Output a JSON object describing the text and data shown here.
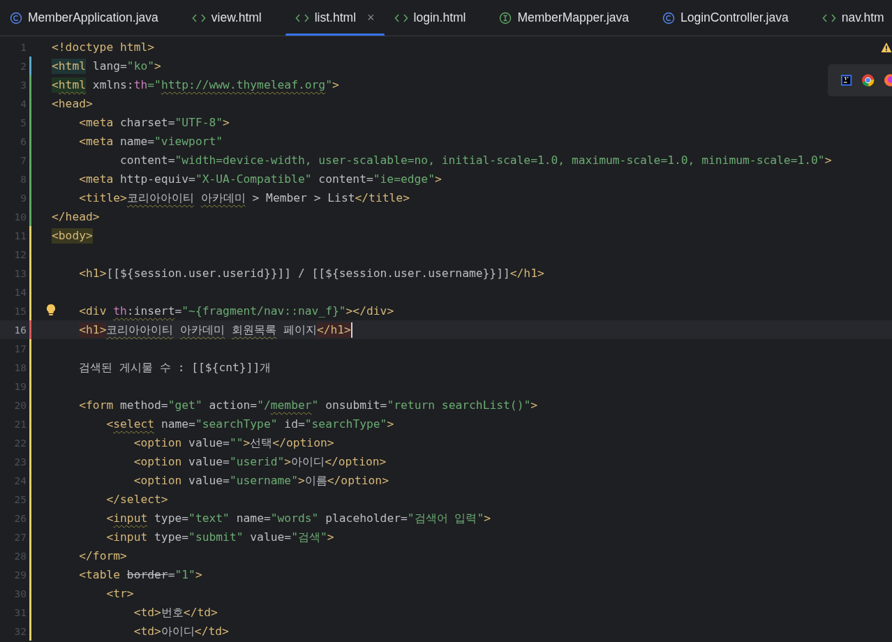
{
  "tabs": [
    {
      "label": "MemberApplication.java",
      "kind": "class",
      "selected": false
    },
    {
      "label": "view.html",
      "kind": "html",
      "selected": false
    },
    {
      "label": "list.html",
      "kind": "html",
      "selected": true,
      "close": "×"
    },
    {
      "label": "login.html",
      "kind": "html",
      "selected": false
    },
    {
      "label": "MemberMapper.java",
      "kind": "interface",
      "selected": false
    },
    {
      "label": "LoginController.java",
      "kind": "class",
      "selected": false
    },
    {
      "label": "nav.htm",
      "kind": "html",
      "selected": false
    }
  ],
  "editor": {
    "warning": true,
    "lines": [
      {
        "n": "1",
        "selected": false,
        "tokens": [
          {
            "t": "<!doctype html>",
            "kind": "tag"
          }
        ]
      },
      {
        "n": "2",
        "selected": false,
        "color": "#5ea7c9",
        "tokens": [
          {
            "t": "<html",
            "kind": "tag",
            "color": "#1f3636"
          },
          {
            "t": " lang=",
            "kind": "attr"
          },
          {
            "t": "\"ko\"",
            "kind": "string"
          },
          {
            "t": ">",
            "kind": "tag"
          }
        ]
      },
      {
        "n": "3",
        "selected": false,
        "color": "#5fa866",
        "tokens": [
          {
            "t": "<",
            "kind": "tag",
            "color": "#1f3524"
          },
          {
            "t": "html",
            "kind": "tag",
            "color": "#1f3524",
            "typo": true
          },
          {
            "t": " xmlns:",
            "kind": "attr"
          },
          {
            "t": "th",
            "kind": "ns"
          },
          {
            "t": "=\"",
            "kind": "string"
          },
          {
            "t": "http://www.thymeleaf.org",
            "kind": "string",
            "typo": true
          },
          {
            "t": "\"",
            "kind": "string"
          },
          {
            "t": ">",
            "kind": "tag"
          }
        ]
      },
      {
        "n": "4",
        "selected": false,
        "color": "#5fa866",
        "tokens": [
          {
            "t": "<head>",
            "kind": "tag"
          }
        ]
      },
      {
        "n": "5",
        "selected": false,
        "color": "#5fa866",
        "tokens": [
          {
            "t": "    <meta",
            "kind": "tag"
          },
          {
            "t": " charset=",
            "kind": "attr"
          },
          {
            "t": "\"UTF-8\"",
            "kind": "string"
          },
          {
            "t": ">",
            "kind": "tag"
          }
        ]
      },
      {
        "n": "6",
        "selected": false,
        "color": "#5fa866",
        "tokens": [
          {
            "t": "    <meta",
            "kind": "tag"
          },
          {
            "t": " name=",
            "kind": "attr"
          },
          {
            "t": "\"viewport\"",
            "kind": "string"
          }
        ]
      },
      {
        "n": "7",
        "selected": false,
        "color": "#5fa866",
        "tokens": [
          {
            "t": "          content=",
            "kind": "attr"
          },
          {
            "t": "\"width=device-width, user-scalable=no, initial-scale=1.0, maximum-scale=1.0, minimum-scale=1.0\"",
            "kind": "string"
          },
          {
            "t": ">",
            "kind": "tag"
          }
        ]
      },
      {
        "n": "8",
        "selected": false,
        "color": "#5fa866",
        "tokens": [
          {
            "t": "    <meta",
            "kind": "tag"
          },
          {
            "t": " http-equiv=",
            "kind": "attr"
          },
          {
            "t": "\"X-UA-Compatible\"",
            "kind": "string"
          },
          {
            "t": " content=",
            "kind": "attr"
          },
          {
            "t": "\"ie=edge\"",
            "kind": "string"
          },
          {
            "t": ">",
            "kind": "tag"
          }
        ]
      },
      {
        "n": "9",
        "selected": false,
        "color": "#5fa866",
        "tokens": [
          {
            "t": "    <title>",
            "kind": "tag"
          },
          {
            "t": "코리아아이티",
            "kind": "text",
            "typo": true
          },
          {
            "t": " 아카데미",
            "kind": "text",
            "typo": true
          },
          {
            "t": " > Member > List",
            "kind": "text"
          },
          {
            "t": "</title>",
            "kind": "tag"
          }
        ]
      },
      {
        "n": "10",
        "selected": false,
        "color": "#5fa866",
        "tokens": [
          {
            "t": "</head>",
            "kind": "tag"
          }
        ]
      },
      {
        "n": "11",
        "selected": false,
        "color": "#e3cf6a",
        "tokens": [
          {
            "t": "<body>",
            "kind": "tag",
            "color": "#3a3920"
          }
        ]
      },
      {
        "n": "12",
        "selected": false,
        "color": "#e3cf6a"
      },
      {
        "n": "13",
        "selected": false,
        "color": "#e3cf6a",
        "tokens": [
          {
            "t": "    <h1>",
            "kind": "tag"
          },
          {
            "t": "[[${session.user.userid}}]] / [[${session.user.username}}]]",
            "kind": "text"
          },
          {
            "t": "</h1>",
            "kind": "tag"
          }
        ]
      },
      {
        "n": "14",
        "selected": false,
        "color": "#e3cf6a"
      },
      {
        "n": "15",
        "selected": false,
        "color": "#e3cf6a",
        "bulb": true,
        "tokens": [
          {
            "t": "    <div",
            "kind": "tag"
          },
          {
            "t": " th",
            "kind": "ns",
            "typo": true
          },
          {
            "t": ":insert",
            "kind": "attr",
            "typo": true
          },
          {
            "t": "=",
            "kind": "attr"
          },
          {
            "t": "\"~{fragment/nav::nav_f}\"",
            "kind": "string"
          },
          {
            "t": "></div>",
            "kind": "tag"
          }
        ]
      },
      {
        "n": "16",
        "selected": true,
        "color": "#d3595d",
        "caret": true,
        "tokens": [
          {
            "t": "    <h1>",
            "kind": "tag",
            "color": "#3b2425"
          },
          {
            "t": "코리아아이티",
            "kind": "text",
            "typo": true
          },
          {
            "t": " 아카데미",
            "kind": "text",
            "typo": true
          },
          {
            "t": " 회원목록",
            "kind": "text",
            "typo": true
          },
          {
            "t": " 페이지",
            "kind": "text"
          },
          {
            "t": "</h1>",
            "kind": "tag",
            "color": "#3b2425"
          }
        ]
      },
      {
        "n": "17",
        "selected": false,
        "color": "#e3cf6a"
      },
      {
        "n": "18",
        "selected": false,
        "color": "#e3cf6a",
        "tokens": [
          {
            "t": "    검색된 게시물 수 : [[${cnt}]]개",
            "kind": "text"
          }
        ]
      },
      {
        "n": "19",
        "selected": false,
        "color": "#e3cf6a"
      },
      {
        "n": "20",
        "selected": false,
        "color": "#e3cf6a",
        "tokens": [
          {
            "t": "    <form",
            "kind": "tag"
          },
          {
            "t": " method=",
            "kind": "attr"
          },
          {
            "t": "\"get\"",
            "kind": "string"
          },
          {
            "t": " action=",
            "kind": "attr"
          },
          {
            "t": "\"/",
            "kind": "string"
          },
          {
            "t": "member",
            "kind": "string",
            "typo": true
          },
          {
            "t": "\"",
            "kind": "string"
          },
          {
            "t": " onsubmit=",
            "kind": "attr"
          },
          {
            "t": "\"return searchList()\"",
            "kind": "string"
          },
          {
            "t": ">",
            "kind": "tag"
          }
        ]
      },
      {
        "n": "21",
        "selected": false,
        "color": "#e3cf6a",
        "tokens": [
          {
            "t": "        <",
            "kind": "tag"
          },
          {
            "t": "select",
            "kind": "tag",
            "typo": true
          },
          {
            "t": " name=",
            "kind": "attr"
          },
          {
            "t": "\"searchType\"",
            "kind": "string"
          },
          {
            "t": " id=",
            "kind": "attr"
          },
          {
            "t": "\"searchType\"",
            "kind": "string"
          },
          {
            "t": ">",
            "kind": "tag"
          }
        ]
      },
      {
        "n": "22",
        "selected": false,
        "color": "#e3cf6a",
        "tokens": [
          {
            "t": "            <option",
            "kind": "tag"
          },
          {
            "t": " value=",
            "kind": "attr"
          },
          {
            "t": "\"\"",
            "kind": "string"
          },
          {
            "t": ">",
            "kind": "tag"
          },
          {
            "t": "선택",
            "kind": "text"
          },
          {
            "t": "</option>",
            "kind": "tag"
          }
        ]
      },
      {
        "n": "23",
        "selected": false,
        "color": "#e3cf6a",
        "tokens": [
          {
            "t": "            <option",
            "kind": "tag"
          },
          {
            "t": " value=",
            "kind": "attr"
          },
          {
            "t": "\"userid\"",
            "kind": "string"
          },
          {
            "t": ">",
            "kind": "tag"
          },
          {
            "t": "아이디",
            "kind": "text"
          },
          {
            "t": "</option>",
            "kind": "tag"
          }
        ]
      },
      {
        "n": "24",
        "selected": false,
        "color": "#e3cf6a",
        "tokens": [
          {
            "t": "            <option",
            "kind": "tag"
          },
          {
            "t": " value=",
            "kind": "attr"
          },
          {
            "t": "\"username\"",
            "kind": "string"
          },
          {
            "t": ">",
            "kind": "tag"
          },
          {
            "t": "이름",
            "kind": "text"
          },
          {
            "t": "</option>",
            "kind": "tag"
          }
        ]
      },
      {
        "n": "25",
        "selected": false,
        "color": "#e3cf6a",
        "tokens": [
          {
            "t": "        </select>",
            "kind": "tag"
          }
        ]
      },
      {
        "n": "26",
        "selected": false,
        "color": "#e3cf6a",
        "tokens": [
          {
            "t": "        <",
            "kind": "tag"
          },
          {
            "t": "input",
            "kind": "tag",
            "typo": true
          },
          {
            "t": " type=",
            "kind": "attr"
          },
          {
            "t": "\"text\"",
            "kind": "string"
          },
          {
            "t": " name=",
            "kind": "attr"
          },
          {
            "t": "\"words\"",
            "kind": "string"
          },
          {
            "t": " placeholder=",
            "kind": "attr"
          },
          {
            "t": "\"검색어 입력\"",
            "kind": "string"
          },
          {
            "t": ">",
            "kind": "tag"
          }
        ]
      },
      {
        "n": "27",
        "selected": false,
        "color": "#e3cf6a",
        "tokens": [
          {
            "t": "        <input",
            "kind": "tag"
          },
          {
            "t": " type=",
            "kind": "attr"
          },
          {
            "t": "\"submit\"",
            "kind": "string"
          },
          {
            "t": " value=",
            "kind": "attr"
          },
          {
            "t": "\"검색\"",
            "kind": "string"
          },
          {
            "t": ">",
            "kind": "tag"
          }
        ]
      },
      {
        "n": "28",
        "selected": false,
        "color": "#e3cf6a",
        "tokens": [
          {
            "t": "    </form>",
            "kind": "tag"
          }
        ]
      },
      {
        "n": "29",
        "selected": false,
        "color": "#e3cf6a",
        "tokens": [
          {
            "t": "    <table",
            "kind": "tag"
          },
          {
            "t": " border",
            "kind": "attr",
            "deprecated": true
          },
          {
            "t": "=",
            "kind": "attr"
          },
          {
            "t": "\"1\"",
            "kind": "string"
          },
          {
            "t": ">",
            "kind": "tag"
          }
        ]
      },
      {
        "n": "30",
        "selected": false,
        "color": "#e3cf6a",
        "tokens": [
          {
            "t": "        <tr>",
            "kind": "tag"
          }
        ]
      },
      {
        "n": "31",
        "selected": false,
        "color": "#e3cf6a",
        "tokens": [
          {
            "t": "            <td>",
            "kind": "tag"
          },
          {
            "t": "번호",
            "kind": "text"
          },
          {
            "t": "</td>",
            "kind": "tag"
          }
        ]
      },
      {
        "n": "32",
        "selected": false,
        "color": "#e3cf6a",
        "tokens": [
          {
            "t": "            <td>",
            "kind": "tag"
          },
          {
            "t": "아이디",
            "kind": "text"
          },
          {
            "t": "</td>",
            "kind": "tag"
          }
        ]
      }
    ]
  }
}
